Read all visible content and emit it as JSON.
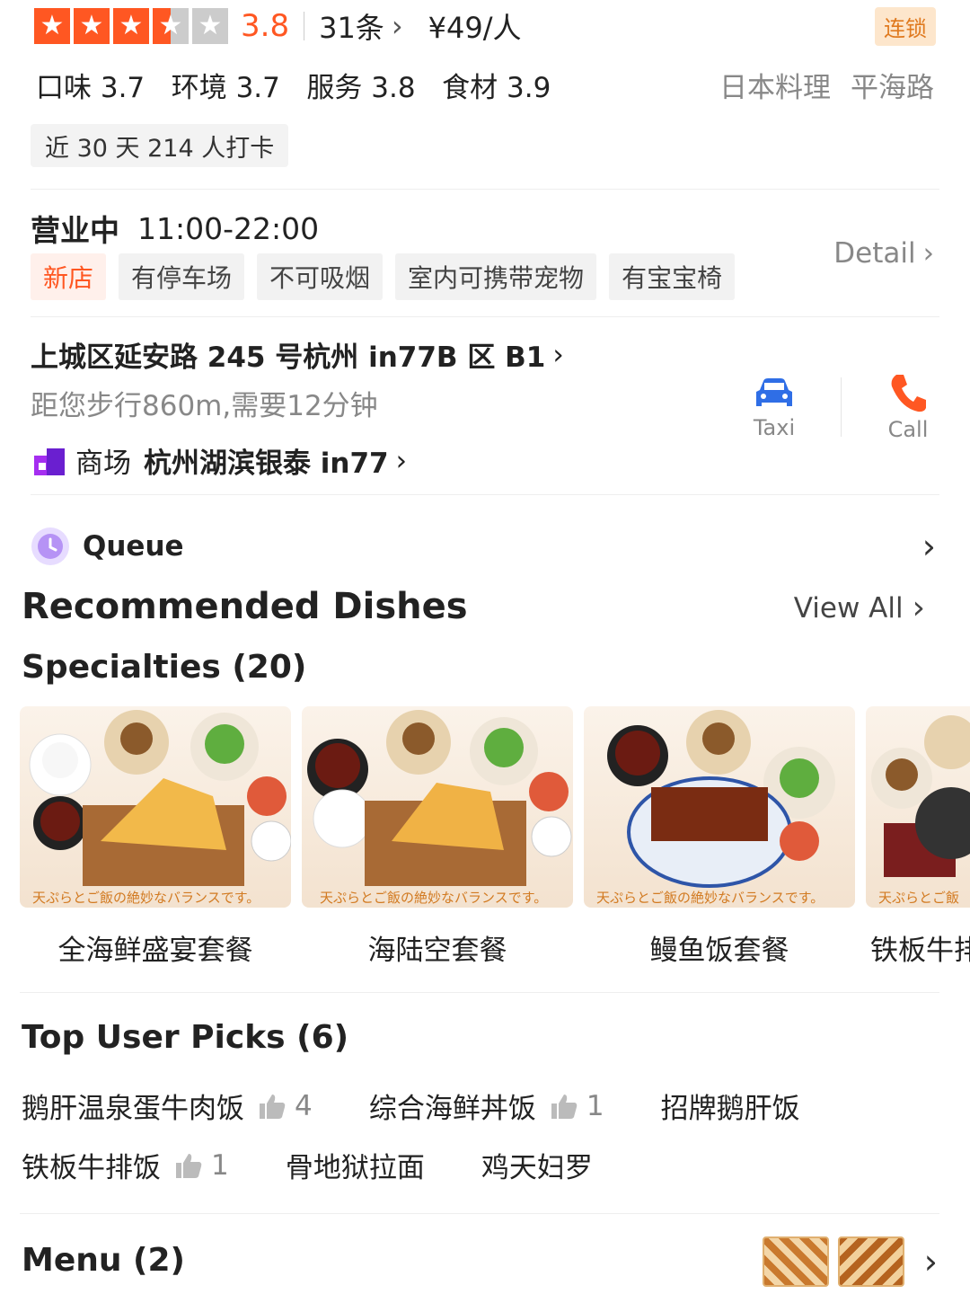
{
  "header": {
    "rating": "3.8",
    "review_count": "31条",
    "price": "¥49/人",
    "chain_badge": "连锁",
    "stars": {
      "filled": 3,
      "half": 1,
      "empty": 1
    },
    "sub_scores": "口味 3.7   环境 3.7   服务 3.8   食材 3.9",
    "cuisine": "日本料理",
    "area": "平海路",
    "checkin": "近 30 天 214 人打卡"
  },
  "hours": {
    "status": "营业中",
    "time": "11:00-22:00",
    "detail": "Detail",
    "tags": [
      "新店",
      "有停车场",
      "不可吸烟",
      "室内可携带宠物",
      "有宝宝椅"
    ]
  },
  "location": {
    "address": "上城区延安路 245 号杭州 in77B 区 B1",
    "distance": "距您步行860m,需要12分钟",
    "mall_label": "商场",
    "mall_name": "杭州湖滨银泰 in77",
    "taxi": "Taxi",
    "call": "Call"
  },
  "queue": {
    "label": "Queue"
  },
  "recommended": {
    "title": "Recommended Dishes",
    "view_all": "View All",
    "specialties_title": "Specialties (20)",
    "dishes": [
      {
        "name": "全海鲜盛宴套餐",
        "caption": "天ぷらとご飯の絶妙なバランスです。"
      },
      {
        "name": "海陆空套餐",
        "caption": "天ぷらとご飯の絶妙なバランスです。"
      },
      {
        "name": "鳗鱼饭套餐",
        "caption": "天ぷらとご飯の絶妙なバランスです。"
      },
      {
        "name": "铁板牛排",
        "caption": "天ぷらとご飯"
      }
    ]
  },
  "top_picks": {
    "title": "Top User Picks (6)",
    "items": [
      {
        "name": "鹅肝温泉蛋牛肉饭",
        "likes": "4"
      },
      {
        "name": "综合海鲜丼饭",
        "likes": "1"
      },
      {
        "name": "招牌鹅肝饭",
        "likes": ""
      },
      {
        "name": "铁板牛排饭",
        "likes": "1"
      },
      {
        "name": "骨地狱拉面",
        "likes": ""
      },
      {
        "name": "鸡天妇罗",
        "likes": ""
      }
    ]
  },
  "menu": {
    "title": "Menu (2)"
  },
  "colors": {
    "accent": "#ff5722",
    "queue_purple": "#b693f5",
    "taxi_blue": "#2f6ee6"
  }
}
